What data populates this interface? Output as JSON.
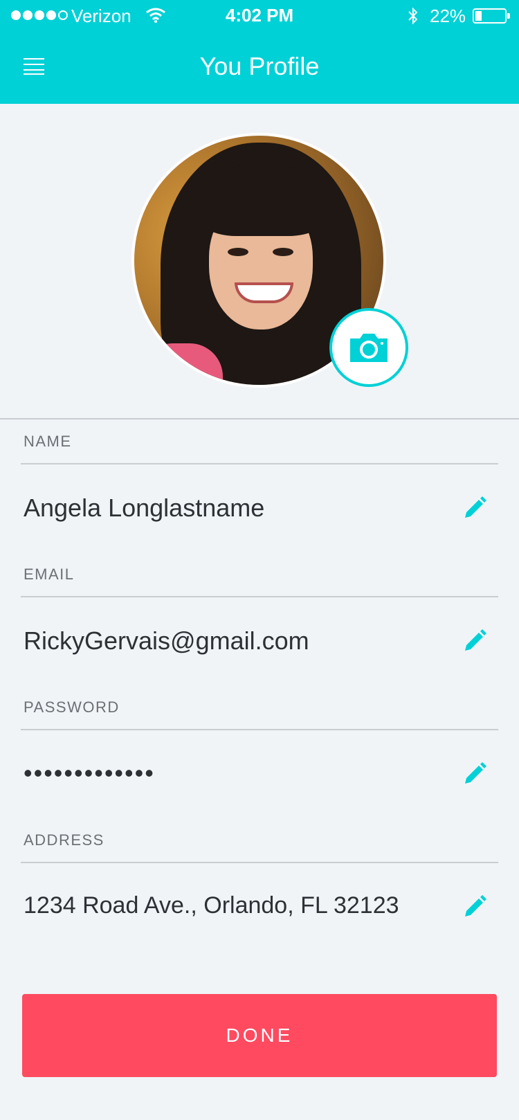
{
  "status_bar": {
    "carrier": "Verizon",
    "time": "4:02 PM",
    "battery_percent": "22%",
    "battery_level": 0.22,
    "signal_bars_filled": 4,
    "signal_bars_total": 5
  },
  "header": {
    "title": "You Profile",
    "menu_icon": "hamburger-menu-icon"
  },
  "profile": {
    "avatar": "profile-photo",
    "camera_icon": "camera-icon"
  },
  "form": {
    "fields": [
      {
        "label": "NAME",
        "value": "Angela Longlastname",
        "edit_icon": "pencil-icon"
      },
      {
        "label": "EMAIL",
        "value": "RickyGervais@gmail.com",
        "edit_icon": "pencil-icon"
      },
      {
        "label": "PASSWORD",
        "value": "•••••••••••••",
        "edit_icon": "pencil-icon"
      },
      {
        "label": "ADDRESS",
        "value": "1234 Road Ave., Orlando, FL 32123",
        "edit_icon": "pencil-icon"
      }
    ]
  },
  "actions": {
    "done_label": "DONE"
  },
  "colors": {
    "accent": "#00d1d6",
    "primary_button": "#ff4a60",
    "background": "#f1f4f7",
    "label_text": "#6c7075",
    "value_text": "#2d3034",
    "divider": "#c9ccd0"
  }
}
